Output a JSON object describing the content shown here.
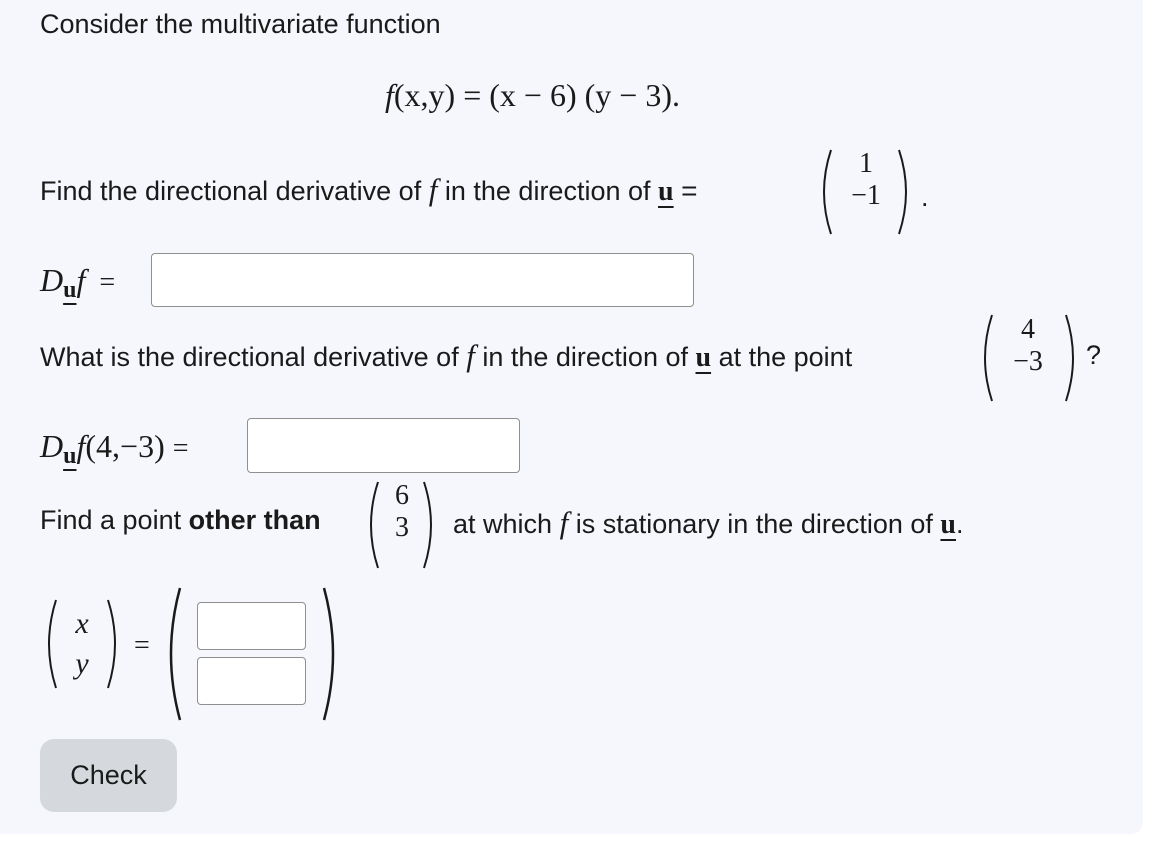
{
  "intro": "Consider the multivariate function",
  "function_display": {
    "f": "f",
    "args": "(x,y) = (x − 6) (y − 3)."
  },
  "q1": {
    "prefix": "Find the directional derivative of",
    "f": "f",
    "middle": "in the direction of",
    "u": "u",
    "eq": "=",
    "vector": [
      "1",
      "−1"
    ],
    "period": "."
  },
  "answer1": {
    "D": "D",
    "u": "u",
    "f": "f",
    "eq": "=",
    "value": ""
  },
  "q2": {
    "prefix": "What is the directional derivative of",
    "f": "f",
    "middle": "in the direction of",
    "u": "u",
    "suffix": "at the point",
    "point": [
      "4",
      "−3"
    ],
    "qmark": "?"
  },
  "answer2": {
    "D": "D",
    "u": "u",
    "f": "f",
    "args": "(4,−3)",
    "eq": "=",
    "value": ""
  },
  "q3": {
    "prefix": "Find a point",
    "bold": "other than",
    "point": [
      "6",
      "3"
    ],
    "middle": "at which",
    "f": "f",
    "suffix": "is stationary in the direction of",
    "u": "u",
    "period": "."
  },
  "answer3": {
    "vars": [
      "x",
      "y"
    ],
    "eq": "=",
    "x_value": "",
    "y_value": ""
  },
  "check_button": "Check"
}
